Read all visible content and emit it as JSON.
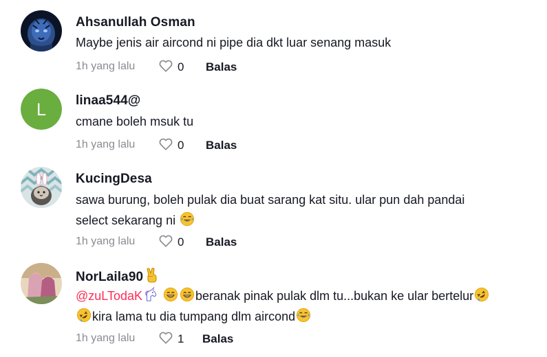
{
  "comments": [
    {
      "author": "Ahsanullah Osman",
      "text": "Maybe jenis air aircond ni pipe dia dkt luar senang masuk",
      "time": "1h yang lalu",
      "likes": "0",
      "reply": "Balas",
      "avatar_icon": "blue-tiger-avatar"
    },
    {
      "author": "linaa544@",
      "text": "cmane boleh msuk tu",
      "time": "1h yang lalu",
      "likes": "0",
      "reply": "Balas",
      "avatar_letter": "L",
      "avatar_color": "#6aae3f"
    },
    {
      "author": "KucingDesa",
      "text_line1": "sawa burung, boleh pulak dia buat sarang kat situ. ular pun dah pandai",
      "text_line2": "select sekarang ni",
      "time": "1h yang lalu",
      "likes": "0",
      "reply": "Balas",
      "avatar_icon": "cat-with-bunny-ears-avatar"
    },
    {
      "author": "NorLaila90",
      "mention": "@zuLTodaK",
      "text_line1": "beranak pinak pulak dlm tu...bukan ke ular bertelur",
      "text_line2": "kira lama tu dia tumpang dlm aircond",
      "time": "1h yang lalu",
      "likes": "1",
      "reply": "Balas",
      "avatar_icon": "two-girls-photo-avatar"
    }
  ],
  "colors": {
    "text": "#161823",
    "muted": "#8a8b91",
    "mention": "#fe2c55"
  }
}
